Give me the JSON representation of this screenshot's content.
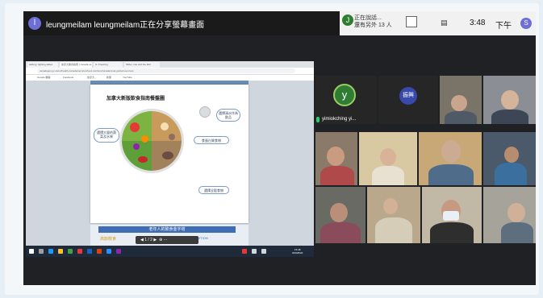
{
  "topbar": {
    "presenter_initial": "l",
    "share_status": "leungmeilam leungmeilam正在分享螢幕畫面",
    "participant_initial": "J",
    "participant_line1": "正在說話...",
    "participant_line2": "還有另外 13 人",
    "clock": "3:48",
    "ampm": "下午",
    "user_initial": "S"
  },
  "browser": {
    "tabs": [
      "asking | lighting slides",
      "加拿大飲食指南 | canada.ca",
      "G: Freezing",
      "Slide | rule and the 2k2"
    ],
    "url": "canadagov.gc.ca/en/health-canada/services/food-nutrition/canada-food-guide/resources",
    "bookmarks": [
      "Google 翻譯",
      "Facebook",
      "加拿大…",
      "新聞",
      "YouTube"
    ]
  },
  "slide": {
    "title": "加拿大新版飲食指南餐盤圖",
    "callout_left": "選擇大量的蔬菜及水果",
    "callout_right_top": "選擇清水作為飲品",
    "callout_right_mid": "食蛋白質食物",
    "callout_right_bottom": "選擇全穀食物",
    "banner": "老年人的飲食金字塔",
    "banner_text_left": "高齡飲食",
    "banner_text_right": "DIET & NUTRITION"
  },
  "slide_controls": {
    "page": "1 / 2"
  },
  "taskbar": {
    "time": "15:48",
    "date": "2020/8/20"
  },
  "gallery": {
    "self_initial": "y",
    "self_name": "yimiokching yi...",
    "guest_label": "振興"
  }
}
